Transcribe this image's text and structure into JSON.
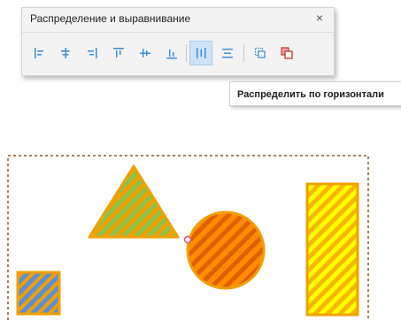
{
  "panel": {
    "title": "Распределение и выравнивание",
    "close_glyph": "×"
  },
  "toolbar": {
    "buttons": [
      {
        "name": "align-left",
        "icon": "align-left-icon",
        "active": false
      },
      {
        "name": "align-center-horizontal",
        "icon": "align-center-horizontal-icon",
        "active": false
      },
      {
        "name": "align-right",
        "icon": "align-right-icon",
        "active": false
      },
      {
        "name": "align-top",
        "icon": "align-top-icon",
        "active": false
      },
      {
        "name": "align-middle-vertical",
        "icon": "align-middle-vertical-icon",
        "active": false
      },
      {
        "name": "align-bottom",
        "icon": "align-bottom-icon",
        "active": false
      },
      {
        "name": "distribute-horizontally",
        "icon": "distribute-horizontally-icon",
        "active": true
      },
      {
        "name": "distribute-vertically",
        "icon": "distribute-vertically-icon",
        "active": false
      },
      {
        "name": "match-width",
        "icon": "match-width-icon",
        "active": false
      },
      {
        "name": "match-size",
        "icon": "match-size-icon",
        "active": false
      }
    ]
  },
  "tooltip": {
    "text": "Распределить по горизонтали"
  },
  "colors": {
    "accent": "#3b8ed8",
    "active_bg": "#cfe3f7",
    "selection_border": "#8a5a1e",
    "shape_outline": "#f0a000",
    "triangle_fill": "#8bc34a",
    "circle_fill": "#ff8c00",
    "circle_stripe": "#e06000",
    "rect_fill": "#ffff00",
    "rect_stripe": "#f5b800",
    "square_fill": "#5b8fd6",
    "handle": "#e0507a"
  }
}
